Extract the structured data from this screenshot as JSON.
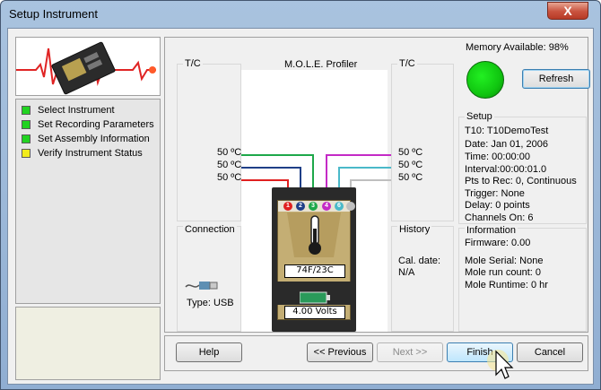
{
  "window": {
    "title": "Setup Instrument",
    "close_glyph": "X"
  },
  "steps": [
    {
      "label": "Select Instrument",
      "color": "#21d321"
    },
    {
      "label": "Set Recording Parameters",
      "color": "#21d321"
    },
    {
      "label": "Set Assembly Information",
      "color": "#21d321"
    },
    {
      "label": "Verify Instrument Status",
      "color": "#f2ec1c"
    }
  ],
  "profiler": {
    "tc_left": "T/C",
    "tc_right": "T/C",
    "title": "M.O.L.E. Profiler",
    "left_temps": [
      "50 ºC",
      "50 ºC",
      "50 ºC"
    ],
    "right_temps": [
      "50 ºC",
      "50 ºC",
      "50 ºC"
    ],
    "channels": [
      {
        "n": "1",
        "color": "#e02020"
      },
      {
        "n": "2",
        "color": "#1f3f87"
      },
      {
        "n": "3",
        "color": "#1ea84a"
      },
      {
        "n": "4",
        "color": "#c42ac6"
      },
      {
        "n": "6",
        "color": "#4ab9c9"
      },
      {
        "n": "",
        "color": "#bfbfbf"
      }
    ],
    "temp_readout": "74F/23C",
    "volt_readout": "4.00 Volts",
    "battery_color": "#2a9a5a"
  },
  "connection": {
    "title": "Connection",
    "type_label": "Type: USB"
  },
  "history": {
    "title": "History",
    "cal_date_label": "Cal. date:",
    "cal_date_value": "N/A"
  },
  "memory": {
    "label": "Memory Available: 98%",
    "status_color": "#10c510"
  },
  "refresh_label": "Refresh",
  "setup": {
    "title": "Setup",
    "lines": [
      "T10: T10DemoTest",
      "Date: Jan 01, 2006",
      "Time: 00:00:00",
      "Interval:00:00:01.0",
      "Pts to Rec: 0, Continuous",
      "Trigger: None",
      "Delay: 0 points",
      "Channels On: 6"
    ]
  },
  "information": {
    "title": "Information",
    "lines": [
      "Firmware: 0.00",
      "Mole Serial: None",
      "Mole run count: 0",
      "Mole Runtime: 0 hr"
    ]
  },
  "buttons": {
    "help": "Help",
    "previous": "<< Previous",
    "next": "Next >>",
    "finish": "Finish",
    "cancel": "Cancel"
  }
}
